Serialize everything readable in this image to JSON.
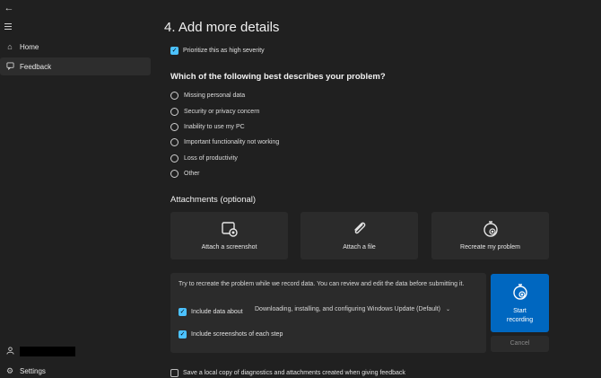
{
  "sidebar": {
    "back_icon": "back-arrow-icon",
    "menu_icon": "hamburger-icon",
    "items": [
      {
        "label": "Home",
        "icon": "home-icon"
      },
      {
        "label": "Feedback",
        "icon": "feedback-icon",
        "selected": true
      }
    ],
    "settings_label": "Settings"
  },
  "main": {
    "title": "4. Add more details",
    "high_severity": {
      "label": "Prioritize this as high severity",
      "checked": true
    },
    "problem_question": "Which of the following best describes your problem?",
    "problem_options": [
      "Missing personal data",
      "Security or privacy concern",
      "Inability to use my PC",
      "Important functionality not working",
      "Loss of productivity",
      "Other"
    ],
    "attachments_heading": "Attachments (optional)",
    "attachments": [
      {
        "label": "Attach a screenshot",
        "icon": "screenshot-icon"
      },
      {
        "label": "Attach a file",
        "icon": "paperclip-icon"
      },
      {
        "label": "Recreate my problem",
        "icon": "stopwatch-icon"
      }
    ],
    "recreate_panel": {
      "description": "Try to recreate the problem while we record data. You can review and edit the data before submitting it.",
      "include_data_label": "Include data about",
      "include_data_checked": true,
      "data_category": "Downloading, installing, and configuring Windows Update (Default)",
      "include_screenshots_label": "Include screenshots of each step",
      "include_screenshots_checked": true
    },
    "start_recording_line1": "Start",
    "start_recording_line2": "recording",
    "cancel_label": "Cancel",
    "save_copy": {
      "label": "Save a local copy of diagnostics and attachments created when giving feedback",
      "checked": false
    }
  },
  "colors": {
    "accent": "#4cc2ff",
    "primary_button": "#0067c0",
    "background": "#202020",
    "card": "#2b2b2b"
  }
}
